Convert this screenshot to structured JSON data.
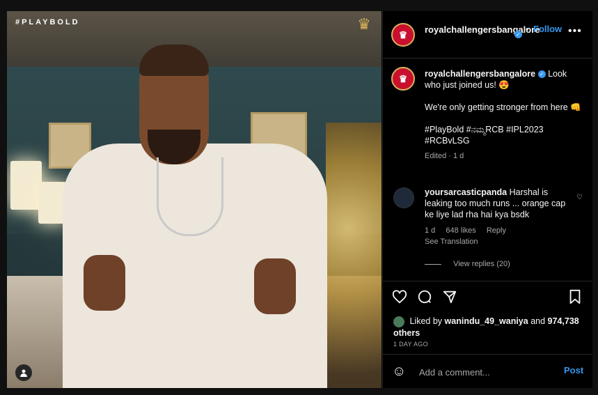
{
  "photo": {
    "tag": "#PLAYBOLD",
    "logo_icon": "rcb-crest-icon",
    "user_tag_icon": "person-icon"
  },
  "header": {
    "username": "royalchallengersbangalore",
    "separator": "•",
    "follow_label": "Follow",
    "more_label": "•••"
  },
  "caption": {
    "username": "royalchallengersbangalore",
    "line1": "Look who just joined us! 😍",
    "line2": "We're only getting stronger from here 👊",
    "line3": "#PlayBold #ನಮ್ಮRCB #IPL2023 #RCBvLSG",
    "meta": "Edited · 1 d"
  },
  "comment": {
    "username": "yoursarcasticpanda",
    "text": "Harshal is leaking too much runs ... orange cap ke liye lad rha hai kya bsdk",
    "age": "1 d",
    "likes": "648 likes",
    "reply_label": "Reply",
    "see_translation": "See Translation",
    "view_replies": "View replies (20)"
  },
  "actions": {
    "liked_by_prefix": "Liked by",
    "liked_by_user": "wanindu_49_waniya",
    "liked_and": "and",
    "liked_count": "974,738 others",
    "time_ago": "1 DAY AGO"
  },
  "add_comment": {
    "placeholder": "Add a comment...",
    "post_label": "Post"
  },
  "colors": {
    "accent": "#3897f0",
    "background": "#000000",
    "brand_red": "#c8102e"
  }
}
